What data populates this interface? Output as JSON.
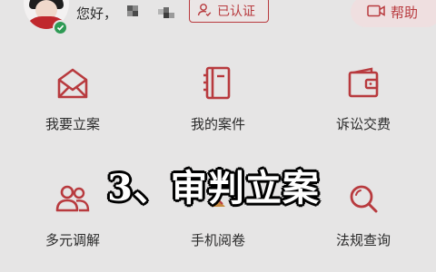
{
  "header": {
    "greeting": "您好，",
    "verified_label": "已认证",
    "help_label": "帮助"
  },
  "colors": {
    "accent": "#b83a3e",
    "background": "#e6e5e5",
    "verified_badge": "#2e9a54"
  },
  "services": [
    {
      "label": "我要立案",
      "icon": "envelope-icon"
    },
    {
      "label": "我的案件",
      "icon": "case-book-icon"
    },
    {
      "label": "诉讼交费",
      "icon": "wallet-icon"
    },
    {
      "label": "多元调解",
      "icon": "people-icon"
    },
    {
      "label": "手机阅卷",
      "icon": "document-icon"
    },
    {
      "label": "法规查询",
      "icon": "search-icon"
    }
  ],
  "overlay_caption": "3、审判立案"
}
